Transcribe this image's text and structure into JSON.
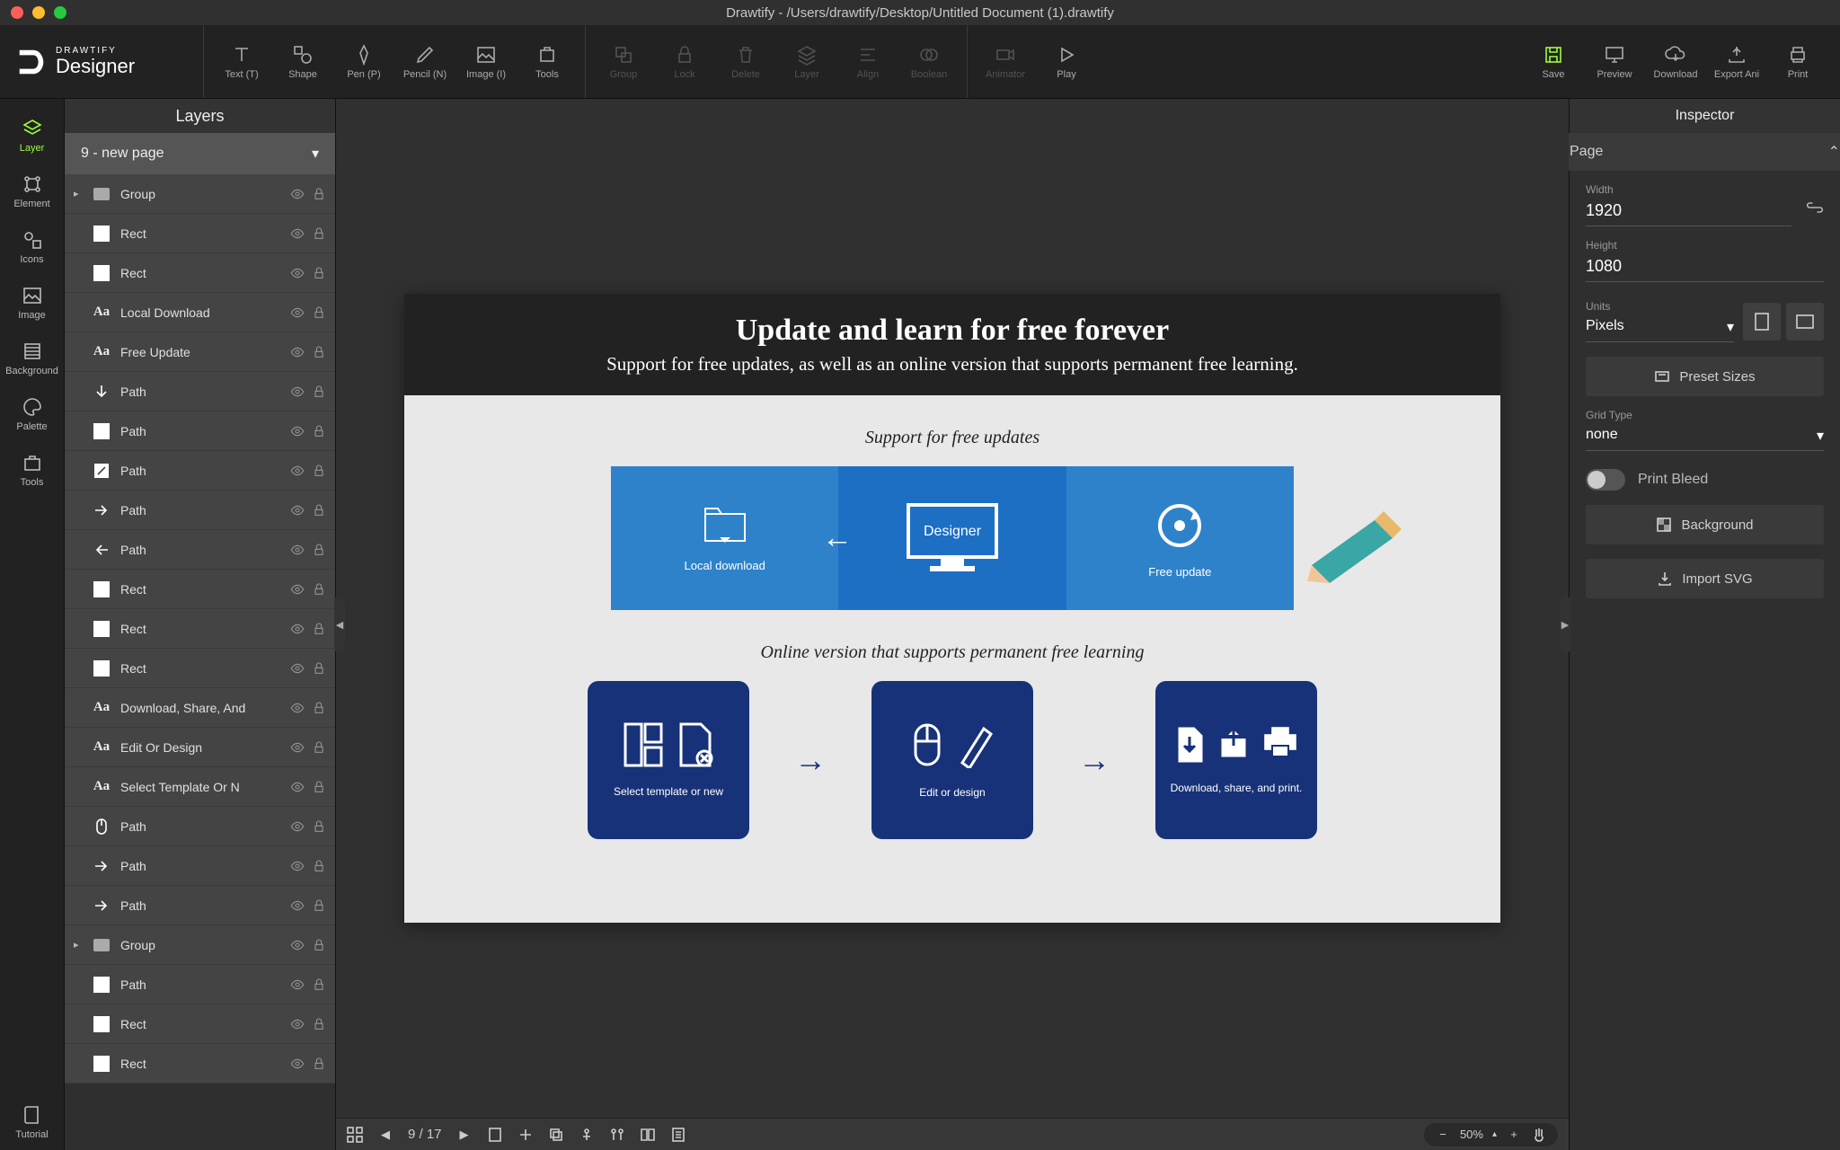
{
  "titlebar": {
    "title": "Drawtify - /Users/drawtify/Desktop/Untitled Document (1).drawtify"
  },
  "logo": {
    "sub": "DRAWTIFY",
    "main": "Designer"
  },
  "tools": {
    "text": "Text (T)",
    "shape": "Shape",
    "pen": "Pen (P)",
    "pencil": "Pencil (N)",
    "image": "Image (I)",
    "tools": "Tools",
    "group": "Group",
    "lock": "Lock",
    "delete": "Delete",
    "layer": "Layer",
    "align": "Align",
    "boolean": "Boolean",
    "animator": "Animator",
    "play": "Play"
  },
  "rightTools": {
    "save": "Save",
    "preview": "Preview",
    "download": "Download",
    "exportAni": "Export Ani",
    "print": "Print"
  },
  "rail": {
    "layer": "Layer",
    "element": "Element",
    "icons": "Icons",
    "image": "Image",
    "background": "Background",
    "palette": "Palette",
    "tools": "Tools",
    "tutorial": "Tutorial"
  },
  "layers": {
    "title": "Layers",
    "pageSelector": "9 - new page",
    "items": [
      {
        "icon": "folder",
        "label": "Group",
        "expand": true
      },
      {
        "icon": "rect",
        "label": "Rect"
      },
      {
        "icon": "rect",
        "label": "Rect"
      },
      {
        "icon": "text",
        "label": "Local Download"
      },
      {
        "icon": "text",
        "label": "Free Update"
      },
      {
        "icon": "arrow-down",
        "label": "Path"
      },
      {
        "icon": "rect",
        "label": "Path"
      },
      {
        "icon": "edit",
        "label": "Path"
      },
      {
        "icon": "arrow-right",
        "label": "Path"
      },
      {
        "icon": "arrow-left",
        "label": "Path"
      },
      {
        "icon": "rect",
        "label": "Rect"
      },
      {
        "icon": "rect",
        "label": "Rect"
      },
      {
        "icon": "rect",
        "label": "Rect"
      },
      {
        "icon": "text",
        "label": "Download, Share, And"
      },
      {
        "icon": "text",
        "label": "Edit Or Design"
      },
      {
        "icon": "text",
        "label": "Select Template Or N"
      },
      {
        "icon": "mouse",
        "label": "Path"
      },
      {
        "icon": "arrow-right",
        "label": "Path"
      },
      {
        "icon": "arrow-right",
        "label": "Path"
      },
      {
        "icon": "folder",
        "label": "Group",
        "expand": true
      },
      {
        "icon": "rect",
        "label": "Path"
      },
      {
        "icon": "rect",
        "label": "Rect"
      },
      {
        "icon": "rect",
        "label": "Rect"
      }
    ]
  },
  "canvas": {
    "heading": "Update and learn for free forever",
    "subhead": "Support for free updates, as well as an online version that supports permanent free learning.",
    "supportText": "Support for free updates",
    "localDownload": "Local download",
    "designer": "Designer",
    "freeUpdate": "Free update",
    "onlineText": "Online version that supports permanent free learning",
    "navy1": "Select template or new",
    "navy2": "Edit or design",
    "navy3": "Download, share, and print."
  },
  "footer": {
    "pagePos": "9 / 17",
    "zoom": "50%"
  },
  "inspector": {
    "title": "Inspector",
    "page": "Page",
    "widthLabel": "Width",
    "width": "1920",
    "heightLabel": "Height",
    "height": "1080",
    "unitsLabel": "Units",
    "units": "Pixels",
    "preset": "Preset Sizes",
    "gridLabel": "Grid Type",
    "grid": "none",
    "bleed": "Print Bleed",
    "background": "Background",
    "importSvg": "Import SVG"
  }
}
